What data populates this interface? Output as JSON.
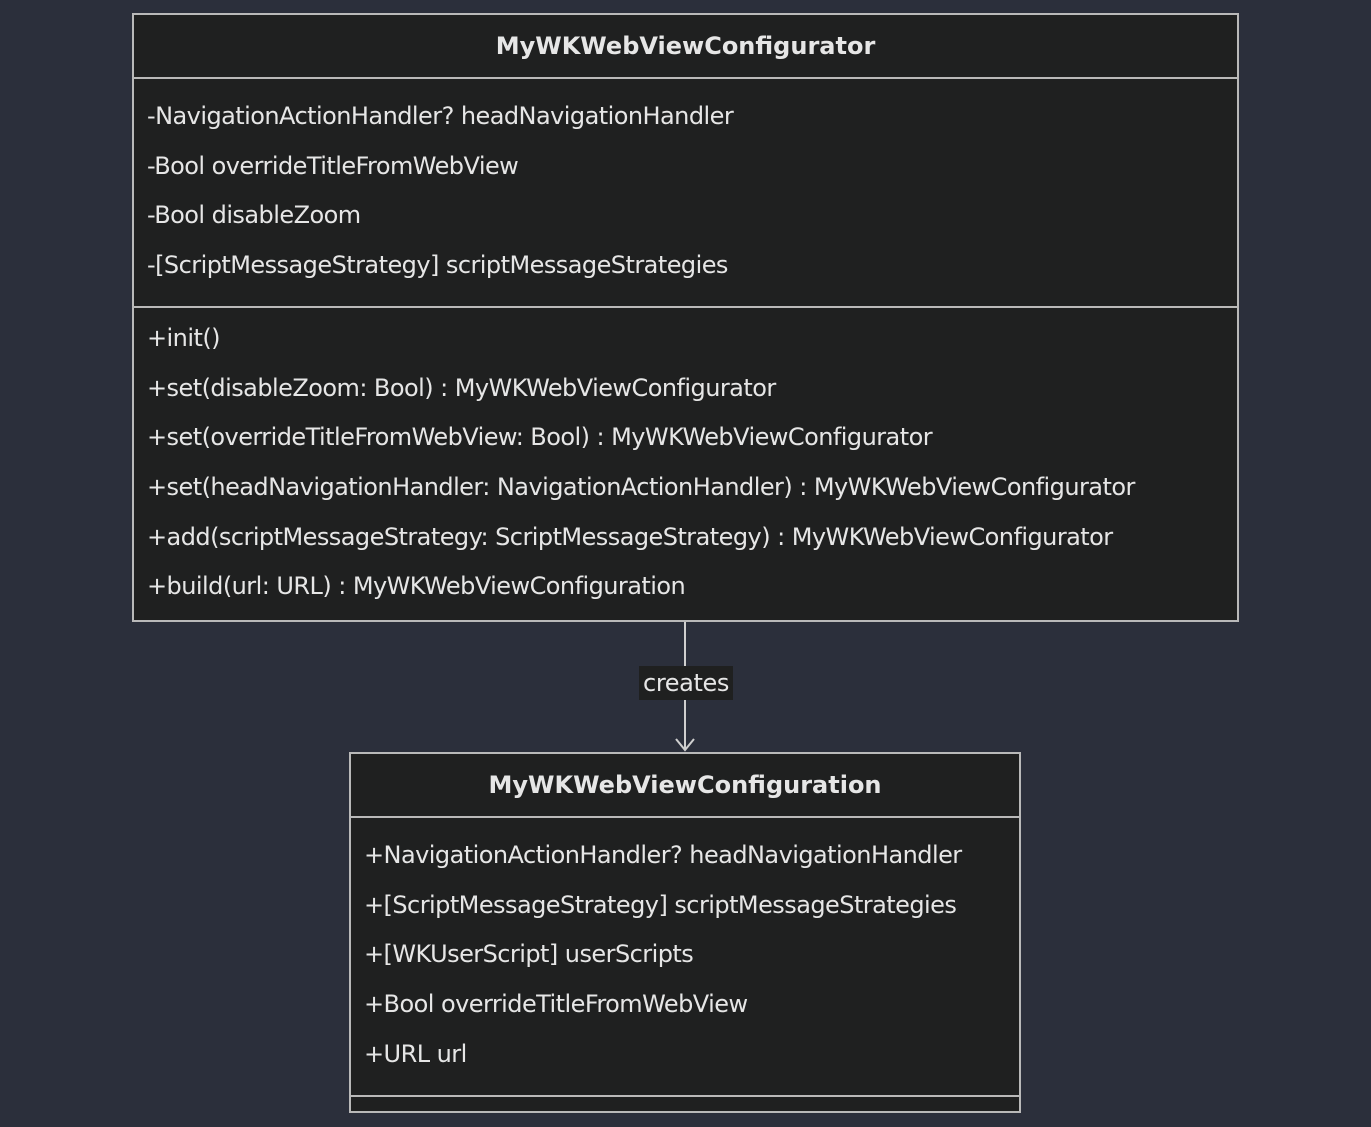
{
  "diagram": {
    "classes": [
      {
        "name": "MyWKWebViewConfigurator",
        "attributes": [
          "-NavigationActionHandler? headNavigationHandler",
          "-Bool overrideTitleFromWebView",
          "-Bool disableZoom",
          "-[ScriptMessageStrategy] scriptMessageStrategies"
        ],
        "methods": [
          "+init()",
          "+set(disableZoom: Bool) : MyWKWebViewConfigurator",
          "+set(overrideTitleFromWebView: Bool) : MyWKWebViewConfigurator",
          "+set(headNavigationHandler: NavigationActionHandler) : MyWKWebViewConfigurator",
          "+add(scriptMessageStrategy: ScriptMessageStrategy) : MyWKWebViewConfigurator",
          "+build(url: URL) : MyWKWebViewConfiguration"
        ]
      },
      {
        "name": "MyWKWebViewConfiguration",
        "attributes": [
          "+NavigationActionHandler? headNavigationHandler",
          "+[ScriptMessageStrategy] scriptMessageStrategies",
          "+[WKUserScript] userScripts",
          "+Bool overrideTitleFromWebView",
          "+URL url"
        ],
        "methods": []
      }
    ],
    "relations": [
      {
        "from": "MyWKWebViewConfigurator",
        "to": "MyWKWebViewConfiguration",
        "label": "creates",
        "arrow": "open-arrowhead"
      }
    ],
    "colors": {
      "background": "#2b2f3b",
      "box_fill": "#1f2020",
      "box_border": "#b9b9b9",
      "text": "#e6e6e6"
    }
  }
}
